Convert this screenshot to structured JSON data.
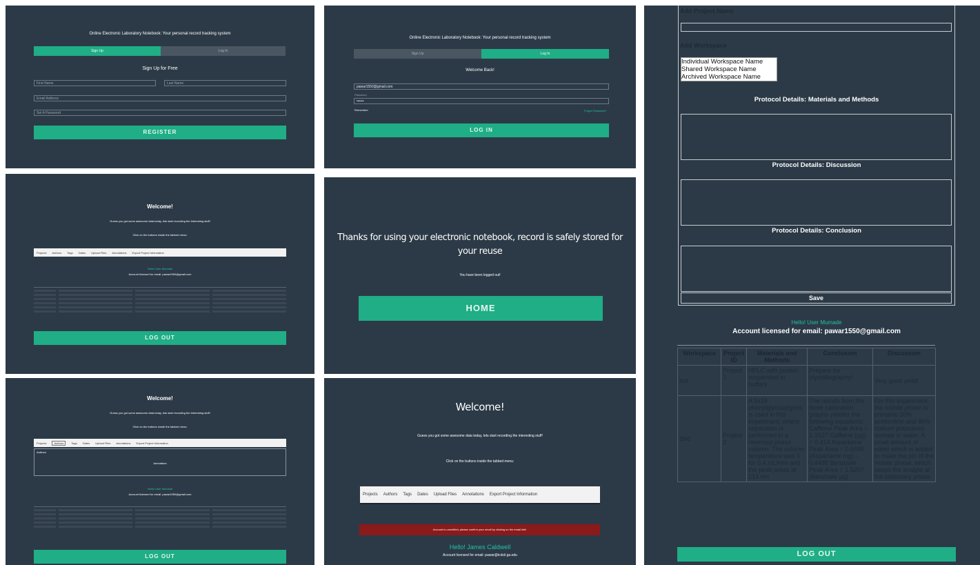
{
  "p1": {
    "title": "Online Electronic Laboratory Notebook: Your personal record tracking system",
    "tab_signup": "Sign Up",
    "tab_login": "Log In",
    "heading": "Sign Up for Free",
    "first_name": "First Name",
    "last_name": "Last Name",
    "email": "Email Address",
    "password": "Set A Password",
    "button": "REGISTER"
  },
  "p2": {
    "title": "Online Electronic Laboratory Notebook: Your personal record tracking system",
    "tab_signup": "Sign Up",
    "tab_login": "Log In",
    "heading": "Welcome Back!",
    "email_value": "pawar1550@gmail.com",
    "password_label": "Password",
    "password_value": "••••••",
    "remember": "Remember",
    "forgot": "Forgot Password?",
    "button": "LOG IN"
  },
  "p3": {
    "title": "Welcome!",
    "line1": "Guess you got some awesome data today, lets start recording the interesting stuff!",
    "line2": "Click on the buttons inside the tabbed menu:",
    "nav": [
      "Projects",
      "Authors",
      "Tags",
      "Dates",
      "Upload Files",
      "Annotations",
      "Export Project Information"
    ],
    "user_link": "Hello! User Mumade",
    "account": "Account licensed for email: pawar1550@gmail.com",
    "button": "LOG OUT"
  },
  "p4": {
    "line1": "Thanks for using your electronic notebook, record is safely stored for",
    "line2": "your reuse",
    "line3": "You have been logged out!",
    "button": "HOME"
  },
  "p5": {
    "title": "Welcome!",
    "line1": "Guess you got some awesome data today, lets start recording the interesting stuff!",
    "line2": "Click on the buttons inside the tabbed menu:",
    "nav": [
      "Projects",
      "Authors",
      "Tags",
      "Dates",
      "Upload Files",
      "Annotations",
      "Export Project Information"
    ],
    "box_label": "Authors",
    "box_value": "Annotators",
    "user_link": "Hello! User Mumade",
    "account": "Account licensed for email: pawar1550@gmail.com",
    "button": "LOG OUT"
  },
  "p6": {
    "title": "Welcome!",
    "line1": "Guess you got some awesome data today, lets start recording the interesting stuff!",
    "line2": "Click on the buttons inside the tabbed menu:",
    "nav": [
      "Projects",
      "Authors",
      "Tags",
      "Dates",
      "Upload Files",
      "Annotations",
      "Export Project Information"
    ],
    "alert": "Account is unverified, please confirm your email by clicking on the email link!",
    "user_link": "Hello! James Caldwell",
    "account": "Account licensed for email: pawar@tcdcil.ga.edu"
  },
  "p7": {
    "project_name_label": "Add Project Name",
    "workspace_label": "Add Workspace",
    "workspace_options": [
      "Individual Workspace Name",
      "Shared Workspace Name",
      "Archived Workspace Name"
    ],
    "materials_label": "Protocol Details: Materials and Methods",
    "discussion_label": "Protocol Details: Discussion",
    "conclusion_label": "Protocol Details: Conclusion",
    "save": "Save",
    "user_link": "Hello! User Mumade",
    "account": "Account licensed for email: pawar1550@gmail.com",
    "table_headers": [
      "Workspace",
      "Project ID",
      "Materials and Methods",
      "Conclusion",
      "Discussion"
    ],
    "rows": [
      [
        "Ind",
        "Project 1",
        "HPLC with protein suspended in buffers",
        "Prepare for crystallography!",
        "Very good yield!"
      ],
      [
        "Shd",
        "Project 2",
        "A 5x15 phenylglycosylgrids is used in this experiment, where separation is performed in a reversed phase column. The column temperature was 3 for 0.4 mL/min and the peak areas at 214 nm",
        "The results from the three calibration graphs yielded the following equations: Caffeine Peak Area = 1.1627 Caffeine (μg) + 0.414 Aspartame Peak Area = 0.5690 (Aspartame mg) - 0.4488 Benzoate Peak Area = 1.5207 (Benzoate μg)",
        "For this experiment, the mobile phase is primarily 20% acetonitrile and 80% sodium potassium acetate in water. A small amount of water which is added to make the pH of the mobile phase, which keeps the analyte at the stationary phase"
      ]
    ],
    "button": "LOG OUT"
  },
  "colors": {
    "background": "#2c3a47",
    "accent": "#1fae86",
    "alert": "#8b1a1a",
    "link": "#22c3a0"
  }
}
